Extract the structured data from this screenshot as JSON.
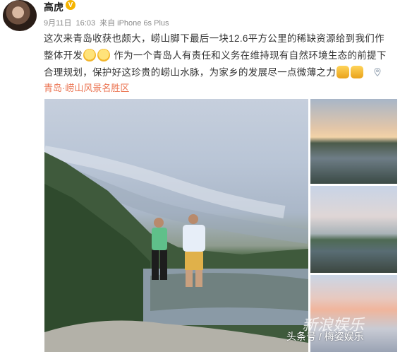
{
  "user": {
    "name": "高虎",
    "verified_badge": "V",
    "avatar": "avatar-photo"
  },
  "meta": {
    "date": "9月11日",
    "time": "16:03",
    "source": "来自 iPhone 6s Plus"
  },
  "post": {
    "line1": "这次来青岛收获也颇大，崂山脚下最后一块12.6平方公里的稀缺资源给到我们作",
    "line2a": "整体开发",
    "line2b": "作为一个青岛人有责任和义务在维持现有自然环境生态的前提下",
    "line3": "合理规划，保护好这珍贵的崂山水脉，为家乡的发展尽一点微薄之力"
  },
  "location": "青岛·崂山风景名胜区",
  "photos": [
    {
      "name": "photo-main",
      "subject": "two men standing on rock by lake at dusk"
    },
    {
      "name": "photo-thumb-1",
      "subject": "lake at sunset"
    },
    {
      "name": "photo-thumb-2",
      "subject": "lake with rocks"
    },
    {
      "name": "photo-thumb-3",
      "subject": "pink sunset clouds"
    }
  ],
  "watermark": {
    "text": "头条号 / 梅姿娱乐",
    "logo": "新浪娱乐"
  },
  "colors": {
    "location": "#eb7350",
    "meta": "#8a8a8a",
    "badge": "#f5b400"
  }
}
